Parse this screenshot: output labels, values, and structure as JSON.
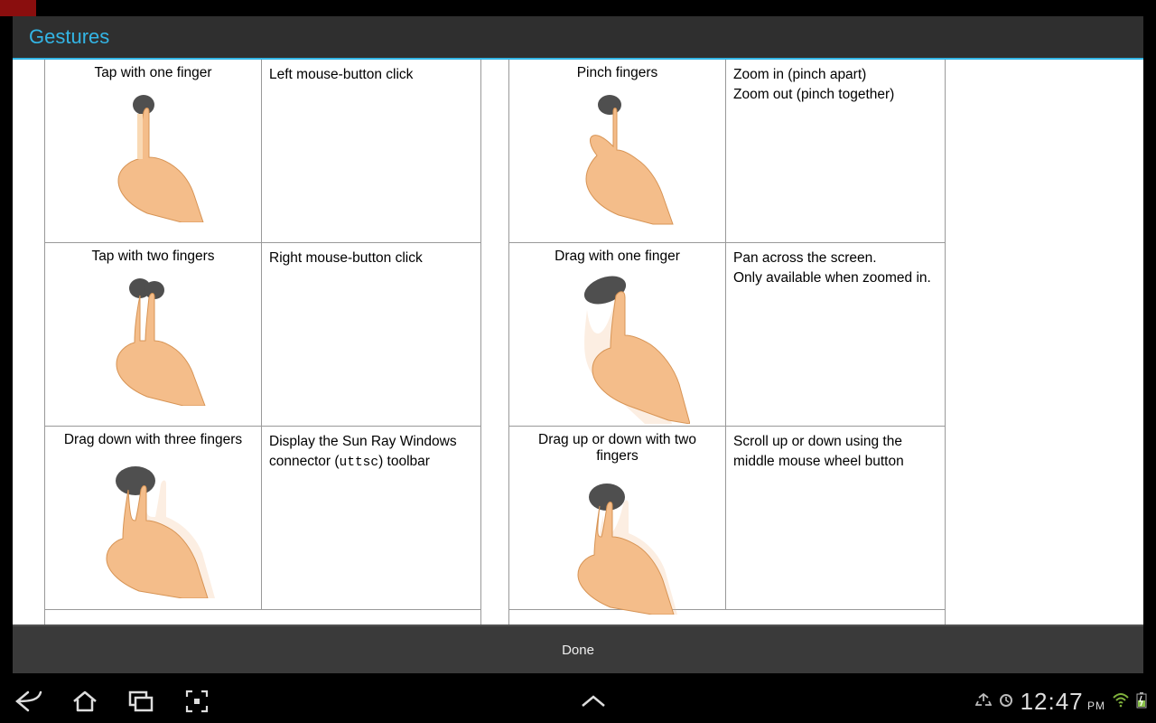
{
  "dialog": {
    "title": "Gestures",
    "done_label": "Done"
  },
  "left_column": [
    {
      "gesture": "Tap with one finger",
      "action": "Left mouse-button click",
      "icon": "one-finger-tap"
    },
    {
      "gesture": "Tap with two fingers",
      "action": "Right mouse-button click",
      "icon": "two-finger-tap"
    },
    {
      "gesture": "Drag down with three fingers",
      "action_prefix": "Display the Sun Ray Windows connector (",
      "action_code": "uttsc",
      "action_suffix": ") toolbar",
      "icon": "three-finger-drag-down"
    }
  ],
  "right_column": [
    {
      "gesture": "Pinch fingers",
      "action": "Zoom in (pinch apart)\nZoom out (pinch together)",
      "icon": "pinch"
    },
    {
      "gesture": "Drag with one finger",
      "action": "Pan across the screen.\nOnly available when zoomed in.",
      "icon": "one-finger-drag"
    },
    {
      "gesture": "Drag up or down with two fingers",
      "action": "Scroll up or down using the middle mouse wheel button",
      "icon": "two-finger-drag"
    }
  ],
  "statusbar": {
    "time": "12:47",
    "ampm": "PM"
  }
}
